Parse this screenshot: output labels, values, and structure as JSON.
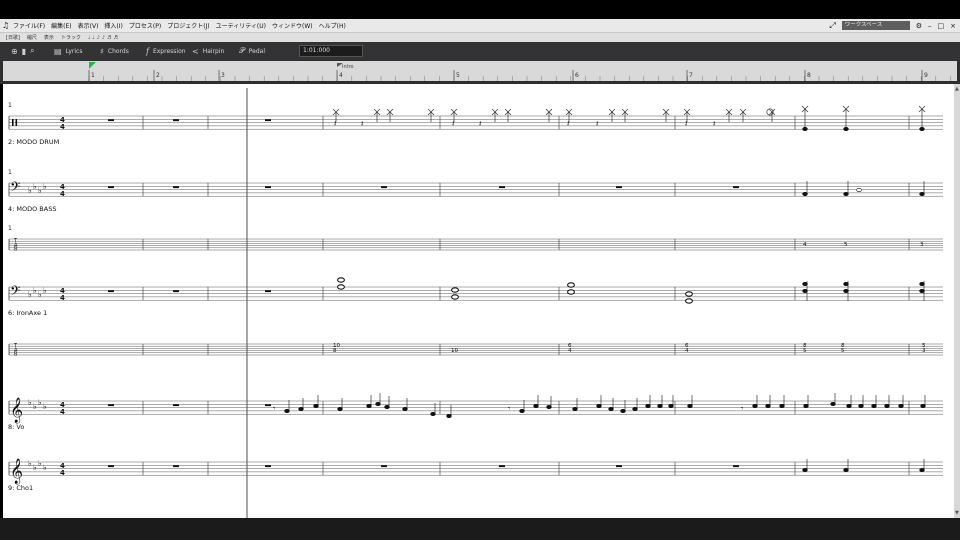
{
  "menubar": {
    "menus": [
      "ファイル(F)",
      "編集(E)",
      "表示(V)",
      "挿入(I)",
      "プロセス(P)",
      "プロジェクト(J)",
      "ユーティリティ(U)",
      "ウィンドウ(W)",
      "ヘルプ(H)"
    ],
    "workspace": "ワークスペース",
    "window_controls": [
      "–",
      "□",
      "×"
    ]
  },
  "subbar": {
    "items": [
      "[日歌]",
      "縮尺",
      "表示",
      "トラック"
    ]
  },
  "toolbar": {
    "lyrics": "Lyrics",
    "chords": "Chords",
    "expression": "Expression",
    "hairpin": "Hairpin",
    "pedal": "Pedal",
    "time": "1:01:000"
  },
  "ruler": {
    "measure_numbers": [
      "1",
      "2",
      "3",
      "4",
      "5",
      "6",
      "7",
      "8",
      "9"
    ],
    "marker_label": "Intro"
  },
  "score": {
    "tracks": [
      {
        "label": "1",
        "clef": "percussion",
        "name_below": "2: MODO DRUM"
      },
      {
        "label": "1",
        "clef": "bass",
        "name_below": "4: MODO BASS"
      },
      {
        "label": "1",
        "clef": "tab",
        "name_below": ""
      },
      {
        "label": "",
        "clef": "bass",
        "name_below": "6: IronAxe 1"
      },
      {
        "label": "",
        "clef": "tab",
        "name_below": ""
      },
      {
        "label": "",
        "clef": "treble",
        "name_below": "8: Vo"
      },
      {
        "label": "",
        "clef": "treble",
        "name_below": "9: Cho1"
      }
    ],
    "time_signature": [
      "4",
      "4"
    ],
    "tab_letters": [
      "T",
      "A",
      "B"
    ],
    "bass_tab_numbers": [
      "4",
      "5",
      "3"
    ],
    "guitar_tab_numbers": [
      {
        "top": "10",
        "bottom": "8"
      },
      {
        "top": "",
        "bottom": "10"
      },
      {
        "top": "",
        "bottom": "8"
      },
      {
        "top": "6",
        "bottom": "4"
      },
      {
        "top": "6",
        "bottom": "4"
      },
      {
        "top": "6",
        "bottom": "4"
      },
      {
        "top": "8",
        "bottom": "5"
      },
      {
        "top": "5",
        "bottom": "3"
      }
    ]
  }
}
